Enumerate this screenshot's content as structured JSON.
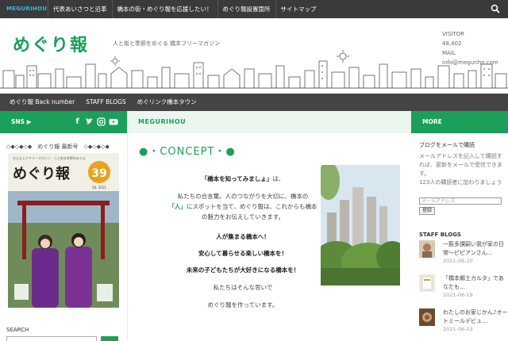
{
  "topbar": {
    "logo": "MEGURIHOU",
    "nav": [
      "代表あいさつと沿革",
      "橋本の街・めぐり報を応援したい！",
      "めぐり報設置箇所",
      "サイトマップ"
    ]
  },
  "header": {
    "brand": "めぐり報",
    "tagline": "人と街と季節をめぐる 橋本フリーマガジン",
    "visitor_label": "VISITOR",
    "visitor_count": "48,402",
    "mail_label": "MAIL",
    "mail_address": "info@meguriho.com"
  },
  "subnav": [
    "めぐり報 Back number",
    "STAFF BLOGS",
    "めぐリンク橋本タウン"
  ],
  "left": {
    "sns_label": "SNS ▶",
    "sns_icons": [
      "facebook-icon",
      "twitter-icon",
      "instagram-icon",
      "youtube-icon"
    ],
    "latest_title": "◇◆◇◆◇◆　めぐり報 最新号　◇◆◇◆◇◆",
    "cover": {
      "title": "めぐり報",
      "issue_no": "39",
      "issue_date": "04. 2021",
      "top_text": "ひとまとアフリーマガジン・人と街を季節をめぐる"
    },
    "search_label": "SEARCH"
  },
  "main": {
    "crumb": "MEGURIHOU",
    "concept": "●・CONCEPT・●",
    "line1_quote": "「橋本を知ってみましょ」",
    "line1_tail": "は、",
    "line2": "私たちの合言葉。人のつながりを大切に、橋本の",
    "line3_person": "「人」",
    "line3_tail": "にスポットを当て、めぐり報は、これからも橋本",
    "line4": "の魅力をお伝えしていきます。",
    "bold1": "人が集まる橋本へ！",
    "bold2": "安心して暮らせる楽しい橋本を！",
    "bold3": "未来の子どもたちが大好きになる橋本を！",
    "line5": "私たちはそんな思いで",
    "line6": "めぐり報を作っています。"
  },
  "right": {
    "more_label": "MORE",
    "mail_title": "ブログをメールで購読",
    "mail_desc": "メールアドレスを記入して購読すれば、更新をメールで受信できます。",
    "mail_count": "123人の購読者に加わりましょう",
    "mail_placeholder": "メールアドレス",
    "mail_button": "登録",
    "staff_title": "STAFF BLOGS",
    "posts": [
      {
        "title": "一筋多讃嗣い我が家の日常〜ピピアンさん…",
        "date": "2021-06-20"
      },
      {
        "title": "「橋本郷土カルタ」であなたも…",
        "date": "2021-06-19"
      },
      {
        "title": "わたしのお家じかん♪オートミールデビュ…",
        "date": "2021-06-13"
      }
    ]
  },
  "colors": {
    "accent": "#1aa05a",
    "dark": "#3a3a3a"
  }
}
